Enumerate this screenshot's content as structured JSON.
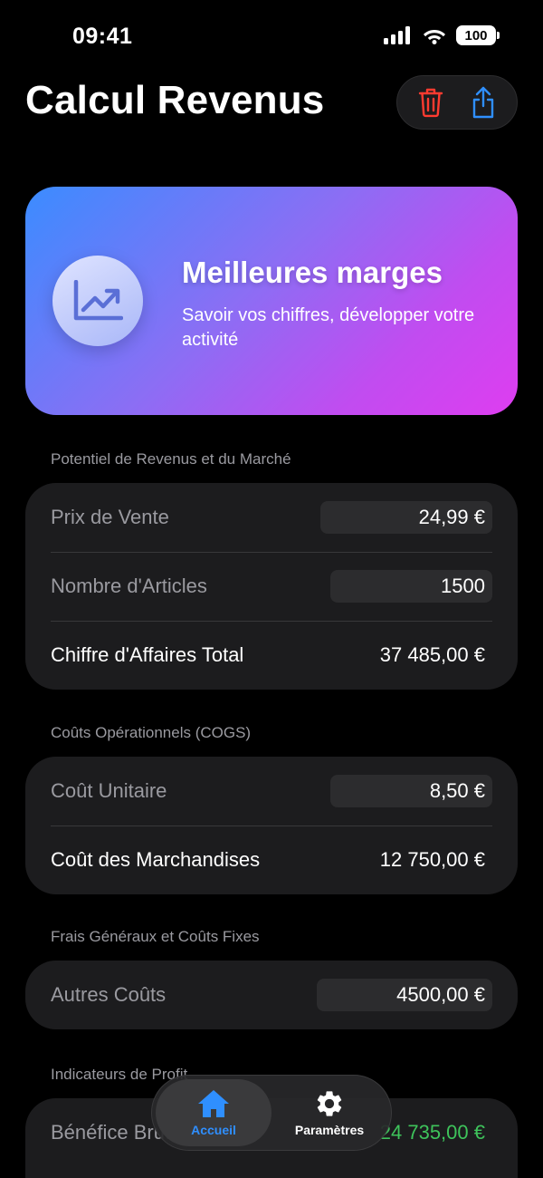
{
  "status_bar": {
    "time": "09:41",
    "battery": "100"
  },
  "header": {
    "title": "Calcul Revenus"
  },
  "hero": {
    "title": "Meilleures marges",
    "subtitle": "Savoir vos chiffres, développer votre activité"
  },
  "sections": {
    "revenue": {
      "header": "Potentiel de Revenus et du Marché",
      "sale_price_label": "Prix de Vente",
      "sale_price_value": "24,99 €",
      "items_label": "Nombre d'Articles",
      "items_value": "1500",
      "total_label": "Chiffre d'Affaires Total",
      "total_value": "37 485,00 €"
    },
    "cogs": {
      "header": "Coûts Opérationnels (COGS)",
      "unit_cost_label": "Coût Unitaire",
      "unit_cost_value": "8,50 €",
      "goods_cost_label": "Coût des Marchandises",
      "goods_cost_value": "12 750,00 €"
    },
    "overhead": {
      "header": "Frais Généraux et Coûts Fixes",
      "other_costs_label": "Autres Coûts",
      "other_costs_value": "4500,00 €"
    },
    "profit": {
      "header": "Indicateurs de Profit",
      "gross_profit_label": "Bénéfice Brut",
      "gross_profit_value": "24 735,00 €"
    }
  },
  "tab_bar": {
    "home_label": "Accueil",
    "settings_label": "Paramètres"
  },
  "colors": {
    "accent": "#2f8fff",
    "danger": "#ff3b30",
    "positive": "#3ec35b",
    "card": "#1c1c1e"
  }
}
